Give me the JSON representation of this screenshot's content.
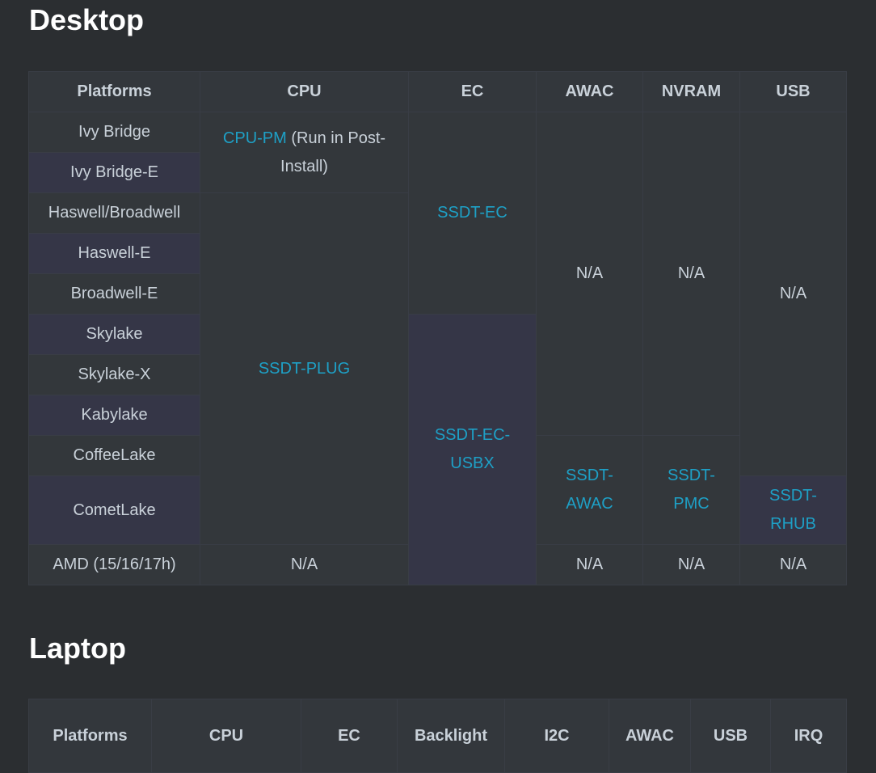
{
  "desktop": {
    "heading": "Desktop",
    "headers": [
      "Platforms",
      "CPU",
      "EC",
      "AWAC",
      "NVRAM",
      "USB"
    ],
    "platforms": [
      "Ivy Bridge",
      "Ivy Bridge-E",
      "Haswell/Broadwell",
      "Haswell-E",
      "Broadwell-E",
      "Skylake",
      "Skylake-X",
      "Kabylake",
      "CoffeeLake",
      "CometLake",
      "AMD (15/16/17h)"
    ],
    "cpu_pm_link": "CPU-PM",
    "cpu_pm_note": " (Run in Post-Install)",
    "ssdt_plug": "SSDT-PLUG",
    "amd_cpu": "N/A",
    "ssdt_ec": "SSDT-EC",
    "ssdt_ec_usbx": "SSDT-EC-USBX",
    "awac_na": "N/A",
    "ssdt_awac": "SSDT-AWAC",
    "amd_awac": "N/A",
    "nvram_na": "N/A",
    "ssdt_pmc": "SSDT-PMC",
    "amd_nvram": "N/A",
    "usb_na": "N/A",
    "ssdt_rhub": "SSDT-RHUB",
    "amd_usb": "N/A"
  },
  "laptop": {
    "heading": "Laptop",
    "headers": [
      "Platforms",
      "CPU",
      "EC",
      "Backlight",
      "I2C",
      "AWAC",
      "USB",
      "IRQ"
    ]
  }
}
